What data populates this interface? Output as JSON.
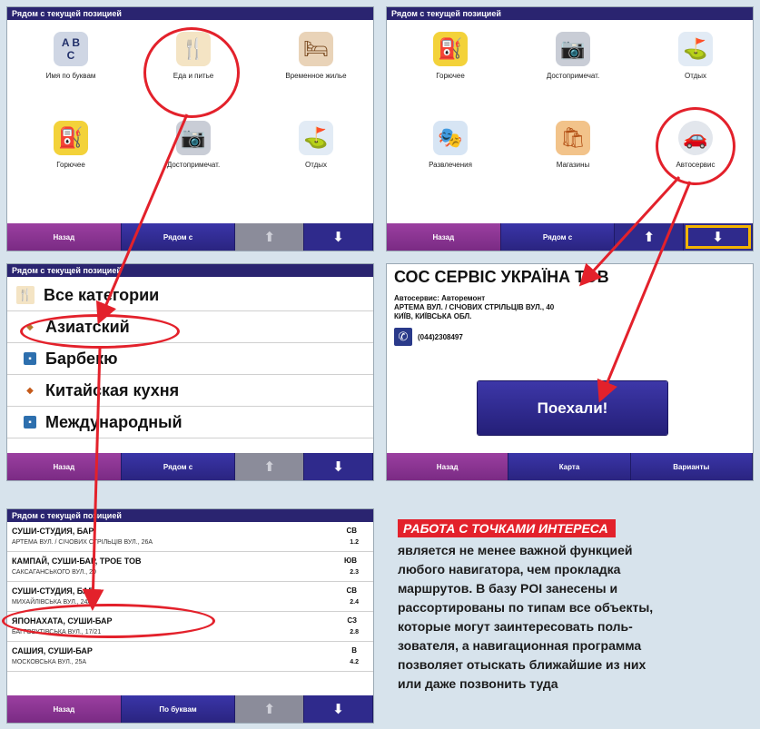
{
  "screen1": {
    "title": "Рядом с текущей позицией",
    "items": [
      {
        "label": "Имя по буквам",
        "icon": "abc-blocks-icon"
      },
      {
        "label": "Еда и питье",
        "icon": "cutlery-icon"
      },
      {
        "label": "Временное жилье",
        "icon": "bed-icon"
      },
      {
        "label": "Горючее",
        "icon": "fuel-pump-icon"
      },
      {
        "label": "Достопримечат.",
        "icon": "camera-icon"
      },
      {
        "label": "Отдых",
        "icon": "golf-icon"
      }
    ],
    "bottom": {
      "back": "Назад",
      "near": "Рядом с"
    }
  },
  "screen2": {
    "title": "Рядом с текущей позицией",
    "items": [
      {
        "label": "Горючее",
        "icon": "fuel-pump-icon"
      },
      {
        "label": "Достопримечат.",
        "icon": "camera-icon"
      },
      {
        "label": "Отдых",
        "icon": "golf-icon"
      },
      {
        "label": "Развлечения",
        "icon": "theater-masks-icon"
      },
      {
        "label": "Магазины",
        "icon": "shopping-bag-icon"
      },
      {
        "label": "Автосервис",
        "icon": "car-service-icon"
      }
    ],
    "bottom": {
      "back": "Назад",
      "near": "Рядом с"
    }
  },
  "screen3": {
    "title": "Рядом с текущей позицией",
    "categories": [
      "Все категории",
      "Азиатский",
      "Барбекю",
      "Китайская кухня",
      "Международный"
    ],
    "bottom": {
      "back": "Назад",
      "near": "Рядом с"
    }
  },
  "screen4": {
    "name": "СОС СЕРВІС УКРАЇНА ТОВ",
    "line1": "Автосервис: Авторемонт",
    "line2": "АРТЕМА ВУЛ. / СІЧОВИХ СТРІЛЬЦІВ ВУЛ., 40",
    "line3": "КИЇВ, КИЇВСЬКА ОБЛ.",
    "phone": "(044)2308497",
    "go_button": "Поехали!",
    "bottom": {
      "back": "Назад",
      "map": "Карта",
      "options": "Варианты"
    }
  },
  "screen5": {
    "title": "Рядом с текущей позицией",
    "results": [
      {
        "name": "СУШИ-СТУДИЯ, БАР",
        "address": "АРТЕМА ВУЛ. / СІЧОВИХ СТРІЛЬЦІВ ВУЛ., 26А",
        "dir": "СВ",
        "dist": "1.2"
      },
      {
        "name": "КАМПАЙ, СУШИ-БАР, ТРОЕ ТОВ",
        "address": "САКСАГАНСЬКОГО ВУЛ., 20",
        "dir": "ЮВ",
        "dist": "2.3"
      },
      {
        "name": "СУШИ-СТУДИЯ, БАР",
        "address": "МИХАЙЛІВСЬКА ВУЛ., 24А",
        "dir": "СВ",
        "dist": "2.4"
      },
      {
        "name": "ЯПОНАХАТА, СУШИ-БАР",
        "address": "БАГГОВУТІВСЬКА ВУЛ., 17/21",
        "dir": "СЗ",
        "dist": "2.8"
      },
      {
        "name": "САШИЯ, СУШИ-БАР",
        "address": "МОСКОВСЬКА ВУЛ., 25А",
        "dir": "В",
        "dist": "4.2"
      }
    ],
    "bottom": {
      "back": "Назад",
      "by_letters": "По буквам"
    }
  },
  "description": {
    "title": "РАБОТА С ТОЧКАМИ ИНТЕРЕСА",
    "body": "является не менее важной функцией\nлюбого навигатора, чем прокладка\nмаршрутов. В базу POI занесены и\nрассортированы по типам все объекты,\nкоторые могут заинтересовать поль-\nзователя, а навигационная программа\nпозволяет отыскать ближайшие из них\nили даже позвонить туда"
  },
  "colors": {
    "accent_red": "#e3212b",
    "bar_blue": "#2f2a8c",
    "back_purple": "#8a3592",
    "highlight": "#f3b400"
  }
}
